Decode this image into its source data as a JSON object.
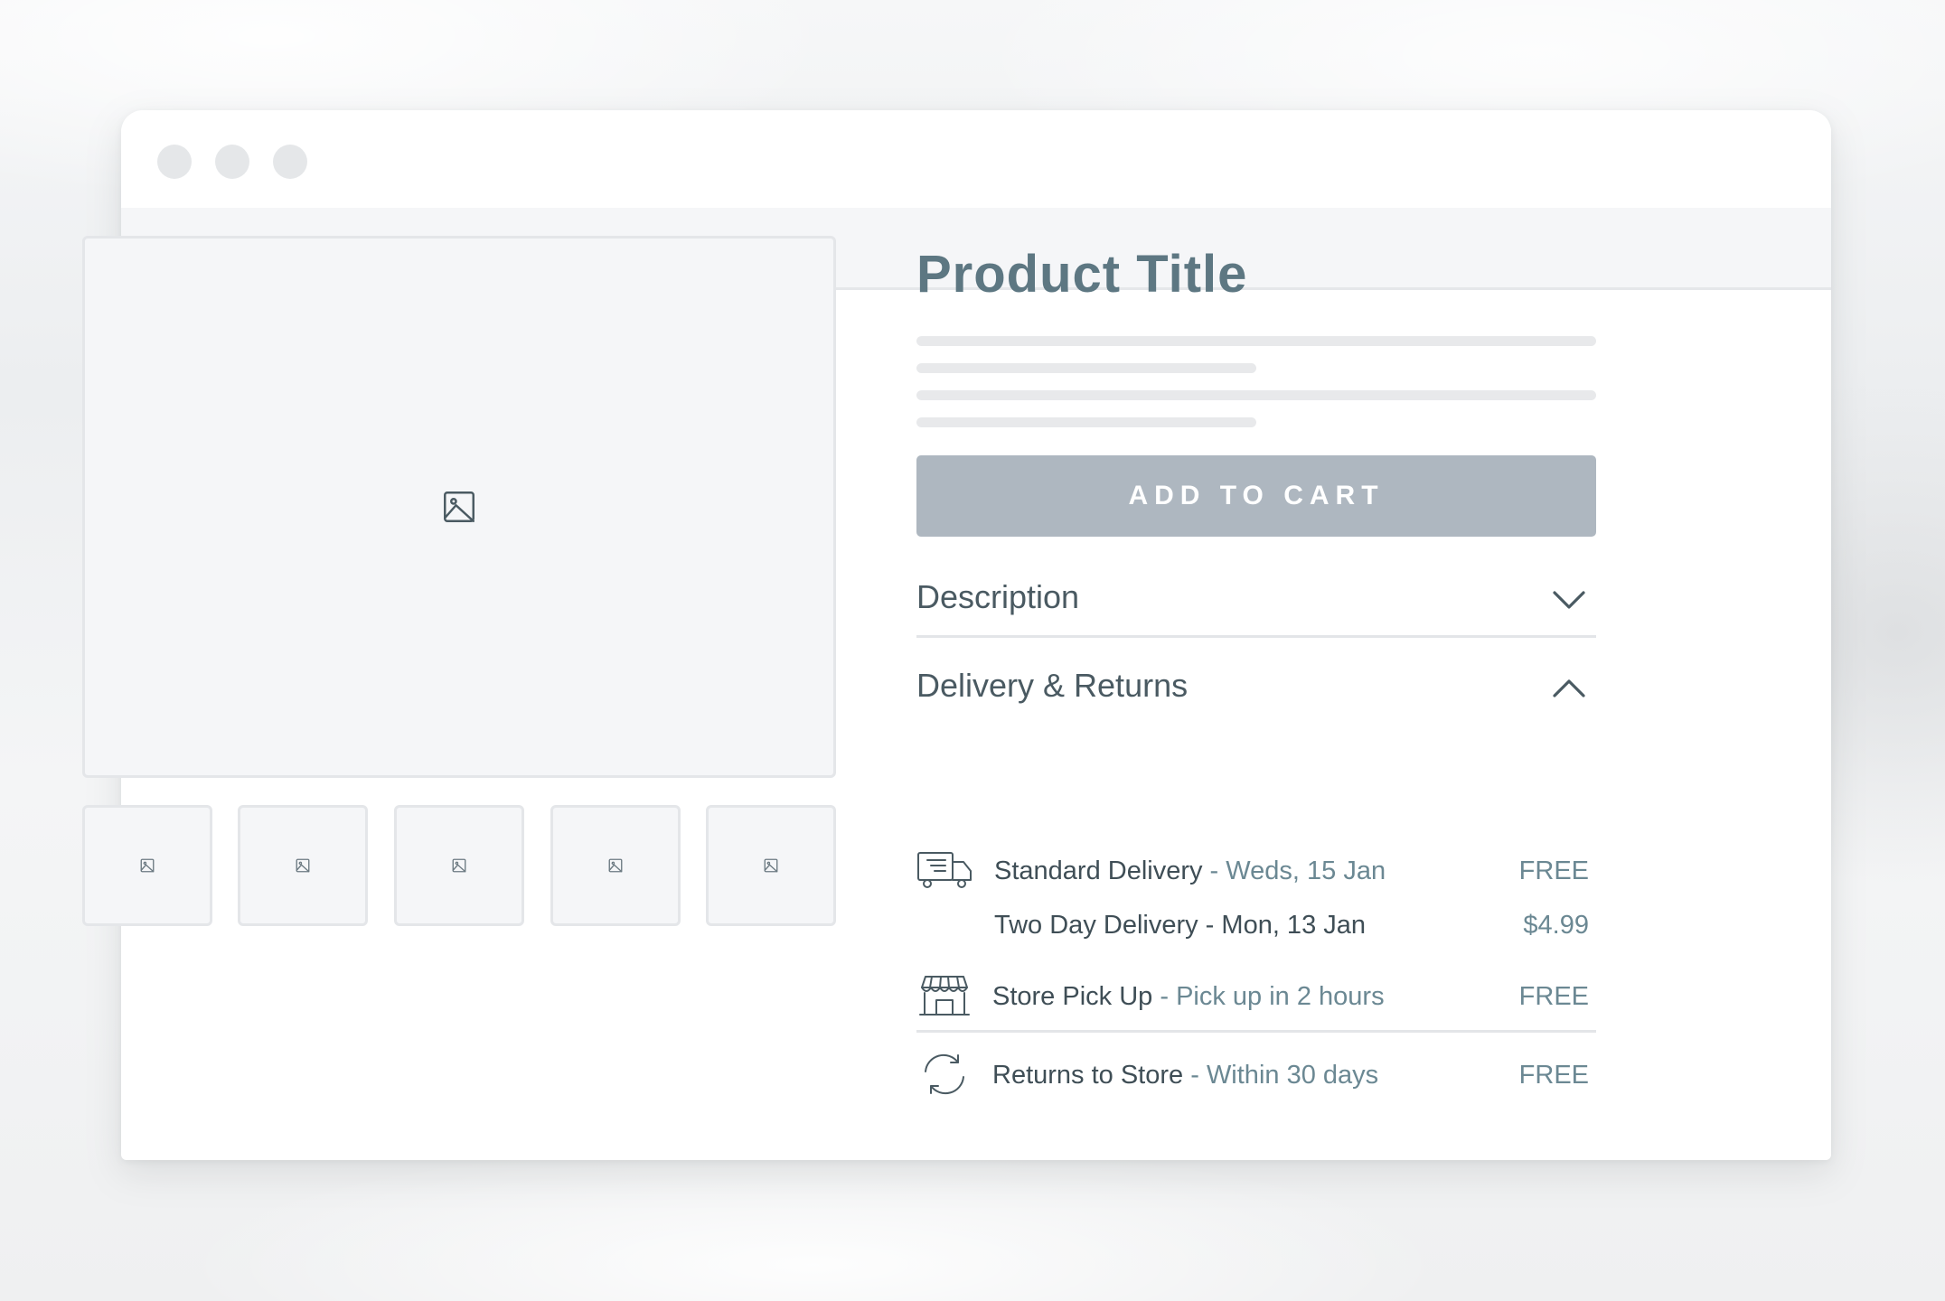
{
  "colors": {
    "title": "#5d7782",
    "text_dark": "#3f4e56",
    "text_accent": "#6b8893",
    "button_bg": "#aeb7c0",
    "button_text": "#ffffff",
    "placeholder_bg": "#f5f6f8",
    "border": "#e4e6e9",
    "window_control": "#e5e7e9"
  },
  "window": {
    "controls": [
      "window-control",
      "window-control",
      "window-control"
    ]
  },
  "product": {
    "title": "Product Title",
    "main_image_icon": "image-icon",
    "thumbnails": [
      {
        "icon": "image-icon"
      },
      {
        "icon": "image-icon"
      },
      {
        "icon": "image-icon"
      },
      {
        "icon": "image-icon"
      },
      {
        "icon": "image-icon"
      }
    ],
    "description_placeholder_lines": 4,
    "add_to_cart_label": "ADD TO CART"
  },
  "accordion": {
    "description": {
      "title": "Description",
      "icon": "chevron-down-icon",
      "expanded": false
    },
    "delivery": {
      "title": "Delivery & Returns",
      "icon": "chevron-up-icon",
      "expanded": true,
      "rows": [
        {
          "icon": "delivery-truck-icon",
          "label": "Standard Delivery",
          "separator": " - ",
          "detail": "Weds, 15 Jan",
          "price": "FREE"
        },
        {
          "icon": "",
          "label": "Two Day Delivery",
          "separator": " - ",
          "detail": "Mon, 13 Jan",
          "price": "$4.99"
        },
        {
          "icon": "store-icon",
          "label": "Store Pick Up",
          "separator": " - ",
          "detail": "Pick up in 2 hours",
          "price": "FREE"
        },
        {
          "icon": "returns-icon",
          "label": "Returns to Store",
          "separator": " - ",
          "detail": "Within 30 days",
          "price": "FREE"
        }
      ]
    }
  }
}
